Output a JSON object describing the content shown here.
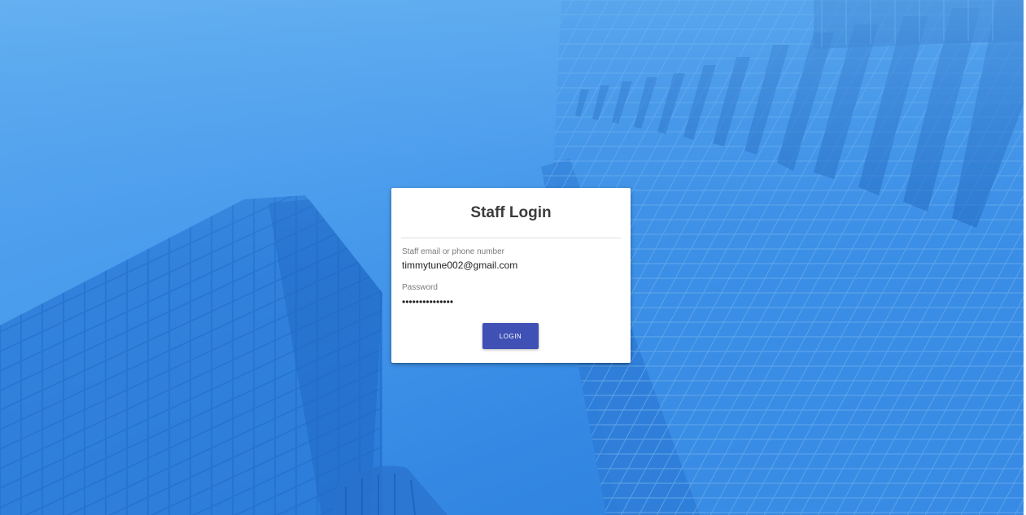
{
  "login_card": {
    "title": "Staff Login",
    "email_field": {
      "label": "Staff email or phone number",
      "value": "timmytune002@gmail.com"
    },
    "password_field": {
      "label": "Password",
      "masked_value": "•••••••••••••••"
    },
    "login_button_label": "LOGIN"
  },
  "colors": {
    "background_blue": "#4a9ced",
    "button_indigo": "#3f51b5",
    "card_white": "#ffffff"
  }
}
